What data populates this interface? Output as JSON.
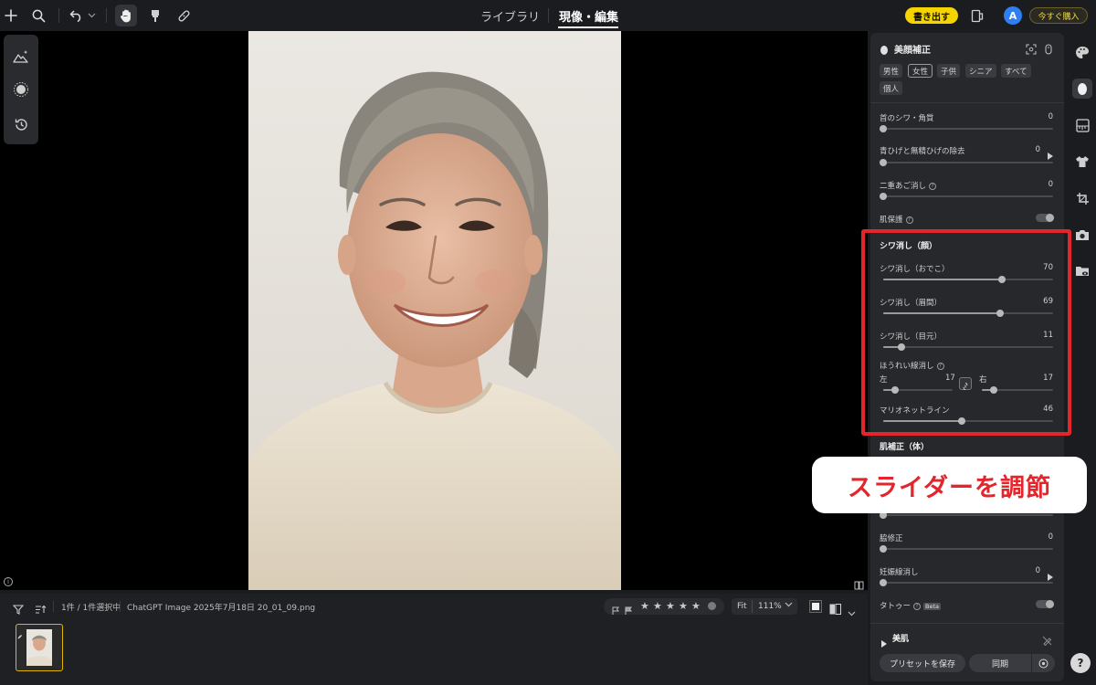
{
  "topbar": {
    "tabs": [
      {
        "label": "ライブラリ",
        "active": false
      },
      {
        "label": "現像・編集",
        "active": true
      }
    ],
    "export_label": "書き出す",
    "avatar_initial": "A",
    "buy_label": "今すぐ購入"
  },
  "filmstrip": {
    "count_text": "1件 / 1件選択中",
    "filename": "ChatGPT Image 2025年7月18日 20_01_09.png",
    "fit_label": "Fit",
    "zoom": "111%",
    "stars": [
      "★",
      "★",
      "★",
      "★",
      "★"
    ]
  },
  "panel": {
    "title": "美顔補正",
    "filters": [
      "男性",
      "女性",
      "子供",
      "シニア",
      "すべて",
      "個人"
    ],
    "selected_filter": "女性",
    "sliders_top": [
      {
        "label": "首のシワ・角質",
        "value": "0",
        "level": 0
      },
      {
        "label": "青ひげと無精ひげの除去",
        "value": "0",
        "level": 0
      },
      {
        "label": "二重あご消し",
        "value": "0",
        "level": 0
      }
    ],
    "skin_protect_label": "肌保護",
    "wrinkle_section": "シワ消し（顔）",
    "wrinkle_sliders": [
      {
        "label": "シワ消し（おでこ）",
        "value": "70",
        "level": 70
      },
      {
        "label": "シワ消し（眉間）",
        "value": "69",
        "level": 69
      },
      {
        "label": "シワ消し（目元）",
        "value": "11",
        "level": 11
      }
    ],
    "nasolabial": {
      "label": "ほうれい線消し",
      "left_label": "左",
      "left_value": "17",
      "left_level": 17,
      "right_label": "右",
      "right_value": "17",
      "right_level": 17
    },
    "marionette": {
      "label": "マリオネットライン",
      "value": "46",
      "level": 46
    },
    "body_section": "肌補正（体）",
    "sliders_bottom": [
      {
        "label": "脇修正",
        "value": "0",
        "level": 0
      },
      {
        "label": "妊娠線消し",
        "value": "0",
        "level": 0
      }
    ],
    "tattoo_label": "タトゥー",
    "beta_label": "Beta",
    "beauty_skin_label": "美肌",
    "save_preset_label": "プリセットを保存",
    "sync_label": "同期"
  },
  "callout_text": "スライダーを調節",
  "help_label": "?"
}
